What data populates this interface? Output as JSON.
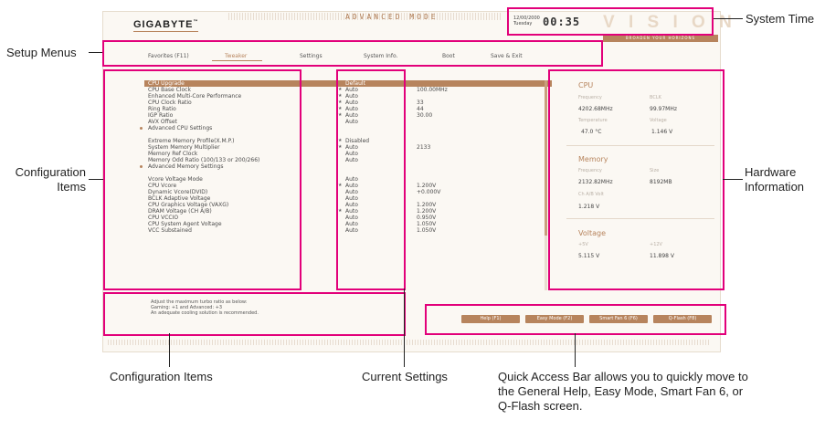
{
  "brand": {
    "logo": "GIGABYTE"
  },
  "header": {
    "mode": "ADVANCED MODE",
    "date": "12/00/2000",
    "day": "Tuesday",
    "time": "00:35",
    "vision": "V I S I O N",
    "tagline": "BROADEN YOUR HORIZONS"
  },
  "menus": [
    "Favorites (F11)",
    "Tweaker",
    "Settings",
    "System Info.",
    "Boot",
    "Save & Exit"
  ],
  "config": {
    "rows": [
      {
        "label": "CPU Upgrade",
        "star": "",
        "value": "Default",
        "value2": ""
      },
      {
        "label": "CPU Base Clock",
        "star": "★",
        "value": "Auto",
        "value2": "100.00MHz"
      },
      {
        "label": "Enhanced Multi-Core Performance",
        "star": "★",
        "value": "Auto",
        "value2": ""
      },
      {
        "label": "CPU Clock Ratio",
        "star": "★",
        "value": "Auto",
        "value2": "33"
      },
      {
        "label": "Ring Ratio",
        "star": "★",
        "value": "Auto",
        "value2": "44"
      },
      {
        "label": "IGP Ratio",
        "star": "★",
        "value": "Auto",
        "value2": "30.00"
      },
      {
        "label": "AVX Offset",
        "star": "",
        "value": "Auto",
        "value2": ""
      },
      {
        "label": "Advanced CPU Settings",
        "star": "",
        "value": "",
        "value2": ""
      },
      {
        "label": "Extreme Memory Profile(X.M.P.)",
        "star": "★",
        "value": "Disabled",
        "value2": ""
      },
      {
        "label": "System Memory Multiplier",
        "star": "★",
        "value": "Auto",
        "value2": "2133"
      },
      {
        "label": "Memory Ref Clock",
        "star": "",
        "value": "Auto",
        "value2": ""
      },
      {
        "label": "Memory Odd Ratio (100/133 or 200/266)",
        "star": "",
        "value": "Auto",
        "value2": ""
      },
      {
        "label": "Advanced Memory Settings",
        "star": "",
        "value": "",
        "value2": ""
      },
      {
        "label": "Vcore Voltage Mode",
        "star": "",
        "value": "Auto",
        "value2": ""
      },
      {
        "label": "CPU Vcore",
        "star": "★",
        "value": "Auto",
        "value2": "1.200V"
      },
      {
        "label": "Dynamic Vcore(DVID)",
        "star": "",
        "value": "Auto",
        "value2": "+0.000V"
      },
      {
        "label": "BCLK Adaptive Voltage",
        "star": "",
        "value": "Auto",
        "value2": ""
      },
      {
        "label": "CPU Graphics Voltage (VAXG)",
        "star": "",
        "value": "Auto",
        "value2": "1.200V"
      },
      {
        "label": "DRAM Voltage    (CH A/B)",
        "star": "★",
        "value": "Auto",
        "value2": "1.200V"
      },
      {
        "label": "CPU VCCIO",
        "star": "",
        "value": "Auto",
        "value2": "0.950V"
      },
      {
        "label": "CPU System Agent Voltage",
        "star": "",
        "value": "Auto",
        "value2": "1.050V"
      },
      {
        "label": "VCC Substained",
        "star": "",
        "value": "Auto",
        "value2": "1.050V"
      }
    ]
  },
  "description": {
    "line1": "Adjust the maximum turbo ratio as below:",
    "line2": "Gaming: +1 and Advanced: +3",
    "line3": "An adequate cooling solution is recommended."
  },
  "hardware": {
    "cpu": {
      "title": "CPU",
      "freq_label": "Frequency",
      "freq": "4202.68MHz",
      "bclk_label": "BCLK",
      "bclk": "99.97MHz",
      "temp_label": "Temperature",
      "temp": "47.0 °C",
      "volt_label": "Voltage",
      "volt": "1.146 V"
    },
    "memory": {
      "title": "Memory",
      "freq_label": "Frequency",
      "freq": "2132.82MHz",
      "size_label": "Size",
      "size": "8192MB",
      "chab_label": "Ch A/B Volt",
      "chab": "1.218 V"
    },
    "voltage": {
      "title": "Voltage",
      "v5_label": "+5V",
      "v5": "5.115 V",
      "v12_label": "+12V",
      "v12": "11.898 V"
    }
  },
  "quick_access": [
    "Help (F1)",
    "Easy Mode (F2)",
    "Smart Fan 6 (F6)",
    "Q-Flash (F8)"
  ],
  "annotations": {
    "system_time": "System Time",
    "setup_menus": "Setup Menus",
    "config_items_left_1": "Configuration",
    "config_items_left_2": "Items",
    "hardware_1": "Hardware",
    "hardware_2": "Information",
    "config_items_bottom": "Configuration Items",
    "current_settings": "Current Settings",
    "quick_1": "Quick Access Bar allows you to quickly move to",
    "quick_2": "the General Help, Easy Mode, Smart Fan 6, or",
    "quick_3": "Q-Flash screen."
  },
  "colors": {
    "accent": "#b7845d",
    "callout": "#e2007a"
  }
}
